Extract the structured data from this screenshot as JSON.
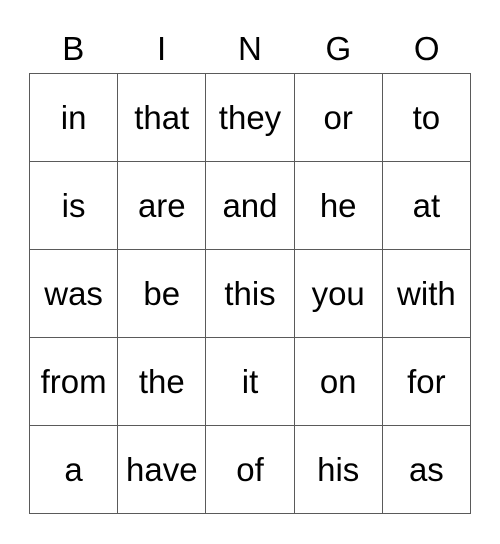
{
  "header": [
    "B",
    "I",
    "N",
    "G",
    "O"
  ],
  "rows": [
    [
      "in",
      "that",
      "they",
      "or",
      "to"
    ],
    [
      "is",
      "are",
      "and",
      "he",
      "at"
    ],
    [
      "was",
      "be",
      "this",
      "you",
      "with"
    ],
    [
      "from",
      "the",
      "it",
      "on",
      "for"
    ],
    [
      "a",
      "have",
      "of",
      "his",
      "as"
    ]
  ]
}
